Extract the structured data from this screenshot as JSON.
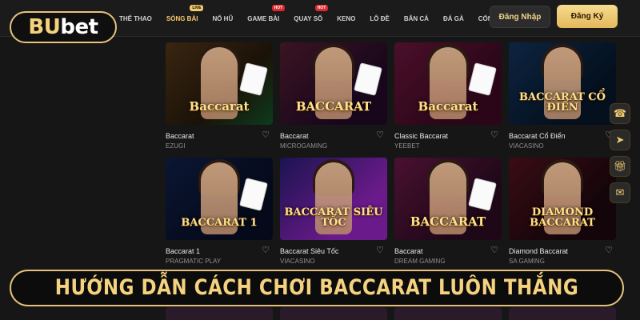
{
  "brand": {
    "logo_prefix": "B",
    "logo_mid": "U",
    "logo_suffix": "bet"
  },
  "nav": [
    {
      "label": "THỂ THAO",
      "badge": ""
    },
    {
      "label": "SÒNG BÀI",
      "badge": "LIVE",
      "active": true
    },
    {
      "label": "NỔ HŨ",
      "badge": ""
    },
    {
      "label": "GAME BÀI",
      "badge": "HOT"
    },
    {
      "label": "QUAY SỐ",
      "badge": "HOT"
    },
    {
      "label": "KENO",
      "badge": ""
    },
    {
      "label": "LÔ ĐỀ",
      "badge": ""
    },
    {
      "label": "BẮN CÁ",
      "badge": ""
    },
    {
      "label": "ĐÁ GÀ",
      "badge": ""
    },
    {
      "label": "CỔNG GAME",
      "badge": ""
    }
  ],
  "auth": {
    "login": "Đăng Nhập",
    "register": "Đăng Ký"
  },
  "games": [
    {
      "name": "Baccarat",
      "provider": "EZUGI",
      "thumb_text": "Baccarat"
    },
    {
      "name": "Baccarat",
      "provider": "MICROGAMING",
      "thumb_text": "BACCARAT"
    },
    {
      "name": "Classic Baccarat",
      "provider": "YEEBET",
      "thumb_text": "Baccarat"
    },
    {
      "name": "Baccarat Cổ Điển",
      "provider": "VIACASINO",
      "thumb_text": "BACCARAT CỔ ĐIỂN"
    },
    {
      "name": "Baccarat 1",
      "provider": "PRAGMATIC PLAY",
      "thumb_text": "BACCARAT 1"
    },
    {
      "name": "Baccarat Siêu Tốc",
      "provider": "VIACASINO",
      "thumb_text": "BACCARAT SIÊU TỐC"
    },
    {
      "name": "Baccarat",
      "provider": "DREAM GAMING",
      "thumb_text": "BACCARAT"
    },
    {
      "name": "Diamond Baccarat",
      "provider": "SA GAMING",
      "thumb_text": "DIAMOND BACCARAT"
    }
  ],
  "side_icons": [
    "phone-icon",
    "telegram-icon",
    "gift-icon",
    "messenger-icon"
  ],
  "banner": {
    "text": "HƯỚNG DẪN CÁCH CHƠI BACCARAT LUÔN THẮNG"
  }
}
